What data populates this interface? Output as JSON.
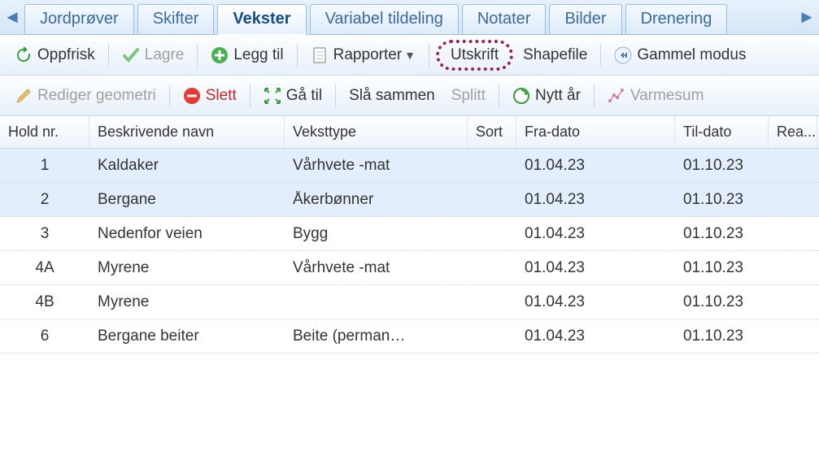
{
  "nav": {
    "prev": "◄",
    "next": "►"
  },
  "tabs": [
    {
      "label": "Jordprøver",
      "active": false
    },
    {
      "label": "Skifter",
      "active": false
    },
    {
      "label": "Vekster",
      "active": true
    },
    {
      "label": "Variabel tildeling",
      "active": false
    },
    {
      "label": "Notater",
      "active": false
    },
    {
      "label": "Bilder",
      "active": false
    },
    {
      "label": "Drenering",
      "active": false
    }
  ],
  "toolbar": {
    "oppfrisk": "Oppfrisk",
    "lagre": "Lagre",
    "leggtil": "Legg til",
    "rapporter": "Rapporter",
    "utskrift": "Utskrift",
    "shapefile": "Shapefile",
    "gammelmodus": "Gammel modus"
  },
  "toolbar2": {
    "rediger": "Rediger geometri",
    "slett": "Slett",
    "gatil": "Gå til",
    "slasammen": "Slå sammen",
    "splitt": "Splitt",
    "nyttar": "Nytt år",
    "varmesum": "Varmesum"
  },
  "columns": {
    "hold": "Hold nr.",
    "navn": "Beskrivende navn",
    "veksttype": "Veksttype",
    "sort": "Sort",
    "fradato": "Fra-dato",
    "tildato": "Til-dato",
    "rea": "Rea..."
  },
  "rows": [
    {
      "hold": "1",
      "navn": "Kaldaker",
      "veksttype": "Vårhvete -mat",
      "sort": "",
      "fra": "01.04.23",
      "til": "01.10.23",
      "sel": true
    },
    {
      "hold": "2",
      "navn": "Bergane",
      "veksttype": "Åkerbønner",
      "sort": "",
      "fra": "01.04.23",
      "til": "01.10.23",
      "sel": true
    },
    {
      "hold": "3",
      "navn": "Nedenfor veien",
      "veksttype": "Bygg",
      "sort": "",
      "fra": "01.04.23",
      "til": "01.10.23",
      "sel": false
    },
    {
      "hold": "4A",
      "navn": "Myrene",
      "veksttype": "Vårhvete -mat",
      "sort": "",
      "fra": "01.04.23",
      "til": "01.10.23",
      "sel": false
    },
    {
      "hold": "4B",
      "navn": "Myrene",
      "veksttype": "",
      "sort": "",
      "fra": "01.04.23",
      "til": "01.10.23",
      "sel": false
    },
    {
      "hold": "6",
      "navn": "Bergane beiter",
      "veksttype": "Beite (perman…",
      "sort": "",
      "fra": "01.04.23",
      "til": "01.10.23",
      "sel": false
    }
  ]
}
